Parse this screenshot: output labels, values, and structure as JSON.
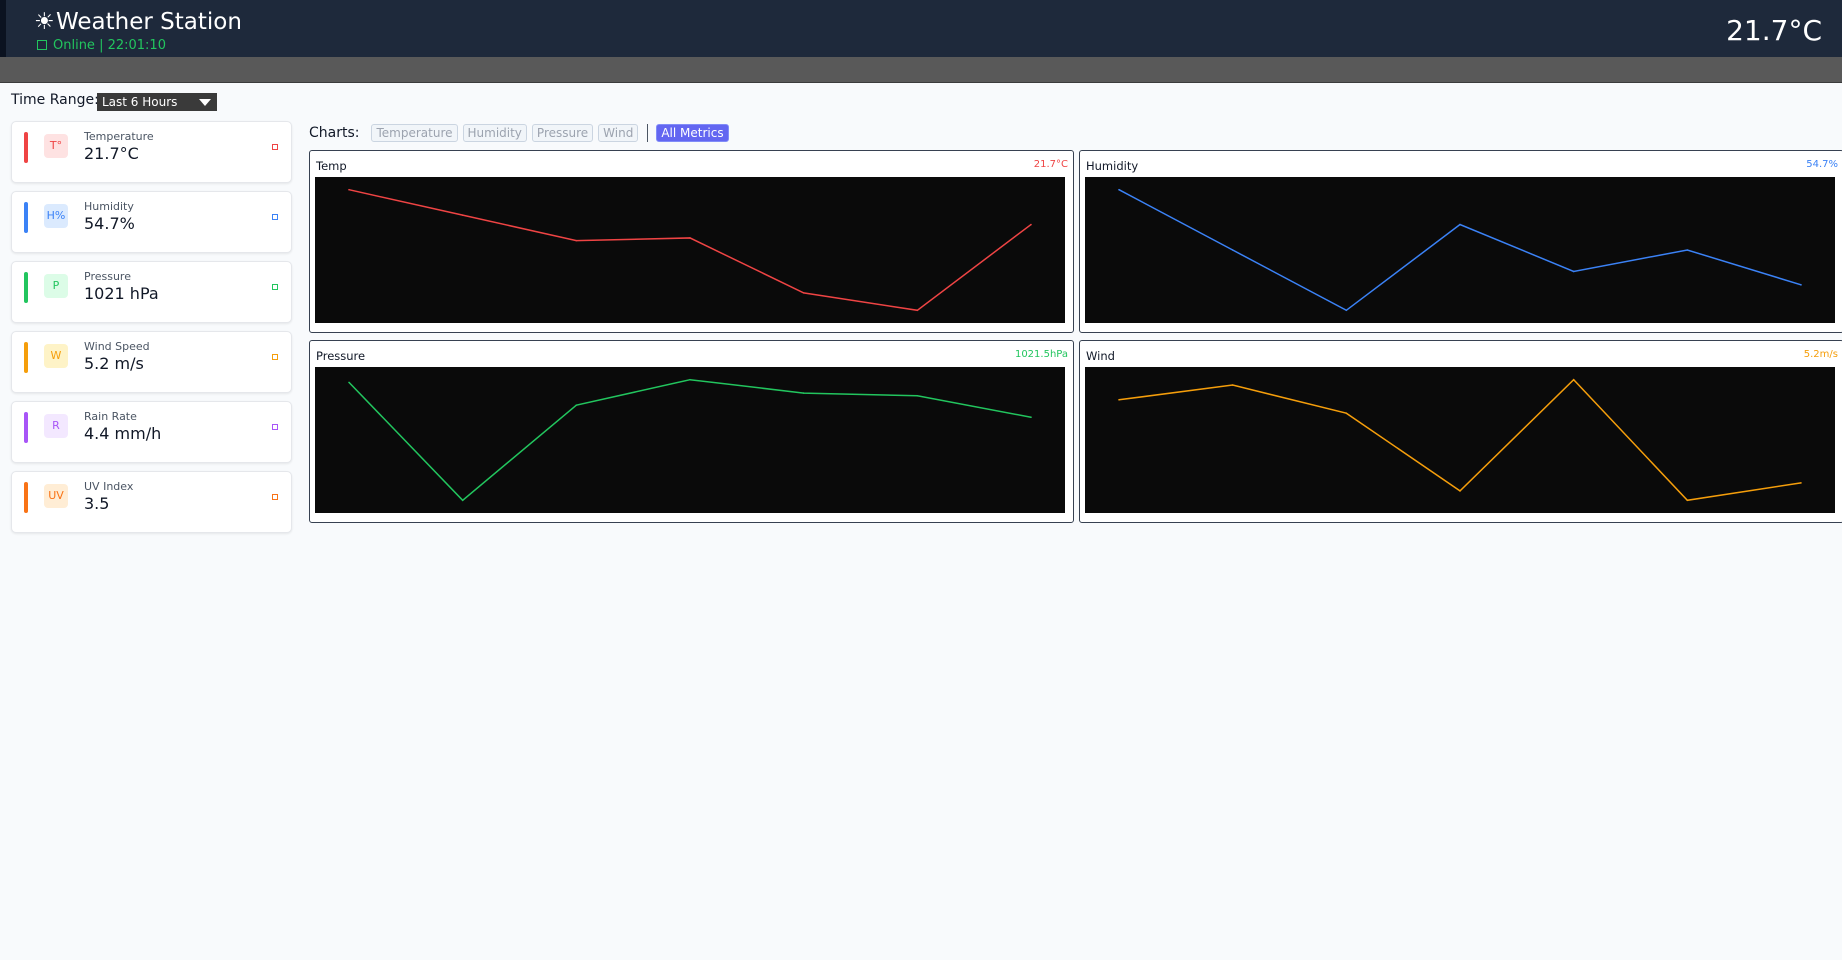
{
  "header": {
    "sun_icon": "☀",
    "title": "Weather Station",
    "status": "Online | 22:01:10",
    "temperature": "21.7°C"
  },
  "controls": {
    "time_range_label": "Time Range:",
    "time_range_value": "Last 6 Hours"
  },
  "sensors": [
    {
      "badge": "T°",
      "label": "Temperature",
      "value": "21.7°C",
      "color": "#ef4444",
      "bg": "#fee2e2"
    },
    {
      "badge": "H%",
      "label": "Humidity",
      "value": "54.7%",
      "color": "#3b82f6",
      "bg": "#dbeafe"
    },
    {
      "badge": "P",
      "label": "Pressure",
      "value": "1021 hPa",
      "color": "#22c55e",
      "bg": "#dcfce7"
    },
    {
      "badge": "W",
      "label": "Wind Speed",
      "value": "5.2 m/s",
      "color": "#f59e0b",
      "bg": "#fef3c7"
    },
    {
      "badge": "R",
      "label": "Rain Rate",
      "value": "4.4 mm/h",
      "color": "#a855f7",
      "bg": "#f3e8ff"
    },
    {
      "badge": "UV",
      "label": "UV Index",
      "value": "3.5",
      "color": "#f97316",
      "bg": "#ffedd5"
    }
  ],
  "charts_bar": {
    "label": "Charts:",
    "chips": [
      "Temperature",
      "Humidity",
      "Pressure",
      "Wind"
    ],
    "active_chip": "All Metrics"
  },
  "chart_data": [
    {
      "type": "line",
      "title": "Temp",
      "current": "21.7°C",
      "color": "#ef4444",
      "values": [
        0.95,
        0.76,
        0.57,
        0.59,
        0.18,
        0.05,
        0.69
      ]
    },
    {
      "type": "line",
      "title": "Humidity",
      "current": "54.7%",
      "color": "#3b82f6",
      "values": [
        0.95,
        0.5,
        0.05,
        0.69,
        0.34,
        0.5,
        0.24
      ]
    },
    {
      "type": "line",
      "title": "Pressure",
      "current": "1021.5hPa",
      "color": "#22c55e",
      "values": [
        0.93,
        0.05,
        0.76,
        0.95,
        0.85,
        0.83,
        0.67
      ]
    },
    {
      "type": "line",
      "title": "Wind",
      "current": "5.2m/s",
      "color": "#f59e0b",
      "values": [
        0.8,
        0.91,
        0.7,
        0.12,
        0.95,
        0.05,
        0.18
      ]
    }
  ]
}
